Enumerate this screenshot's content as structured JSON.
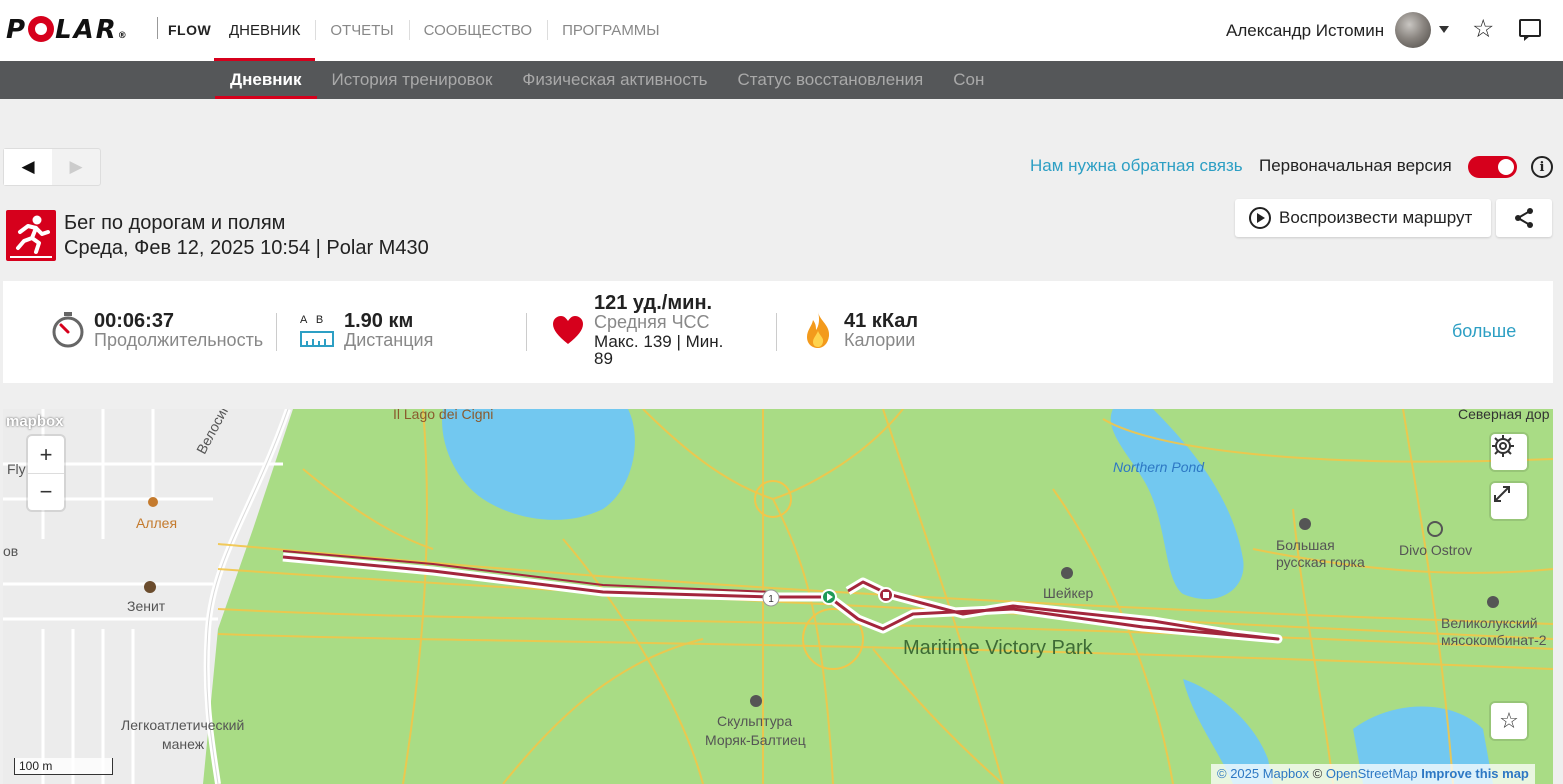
{
  "app": {
    "brand": "POLAR",
    "product": "FLOW"
  },
  "main_nav": [
    {
      "label": "ДНЕВНИК",
      "active": true
    },
    {
      "label": "ОТЧЕТЫ",
      "active": false
    },
    {
      "label": "СООБЩЕСТВО",
      "active": false
    },
    {
      "label": "ПРОГРАММЫ",
      "active": false
    }
  ],
  "user": {
    "name": "Александр Истомин"
  },
  "sub_nav": [
    {
      "label": "Дневник",
      "active": true
    },
    {
      "label": "История тренировок",
      "active": false
    },
    {
      "label": "Физическая активность",
      "active": false
    },
    {
      "label": "Статус восстановления",
      "active": false
    },
    {
      "label": "Сон",
      "active": false
    }
  ],
  "pager": {
    "prev": "◀",
    "next": "▶"
  },
  "feedback_link": "Нам нужна обратная связь",
  "original_version": {
    "label": "Первоначальная версия",
    "enabled": true
  },
  "activity": {
    "title": "Бег по дорогам и полям",
    "subtitle": "Среда, Фев 12, 2025 10:54 | Polar M430",
    "replay_label": "Воспроизвести маршрут"
  },
  "stats": {
    "duration": {
      "value": "00:06:37",
      "label": "Продолжительность"
    },
    "distance": {
      "value": "1.90 км",
      "label": "Дистанция",
      "icon_letters": "A   B"
    },
    "heart_rate": {
      "value": "121 уд./мин.",
      "label": "Средняя ЧСС",
      "line1": "Макс. 139  |  Мин.",
      "line2": "89"
    },
    "calories": {
      "value": "41 кКал",
      "label": "Калории"
    },
    "more": "больше"
  },
  "map": {
    "brand": "mapbox",
    "labels": {
      "lake_cygnets": "Il Lago dei Cigni",
      "north_road": "Северная дор",
      "bike_alley": "Велосипедная алл",
      "northern_pond": "Northern Pond",
      "fly": "Fly",
      "alley": "Аллея",
      "ov": "ов",
      "zenit": "Зенит",
      "shaker": "Шейкер",
      "big_hill_1": "Большая",
      "big_hill_2": "русская горка",
      "divo": "Divo Ostrov",
      "park": "Maritime Victory Park",
      "meat_1": "Великолукский",
      "meat_2": "мясокомбинат-2",
      "athletics_1": "Легкоатлетический",
      "athletics_2": "манеж",
      "sculpture_1": "Скульптура",
      "sculpture_2": "Моряк-Балтиец",
      "lap_marker": "1"
    },
    "scale": "100 m",
    "attribution": {
      "mapbox": "© 2025 Mapbox",
      "osm": "OpenStreetMap",
      "improve": "Improve this map"
    }
  },
  "colors": {
    "accent": "#d6001c",
    "link": "#2d9fc4",
    "park": "#a9dc85",
    "water": "#72c8f0",
    "road": "#f2c64a",
    "route": "#a3263c"
  }
}
